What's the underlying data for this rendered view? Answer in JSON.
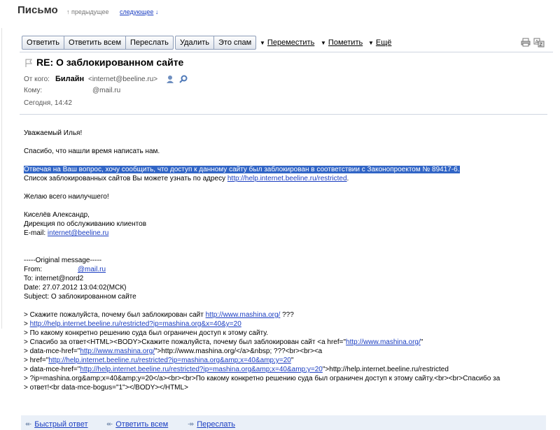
{
  "header": {
    "title": "Письмо",
    "prev_label": "предыдущее",
    "next_label": "следующее"
  },
  "toolbar": {
    "reply": "Ответить",
    "reply_all": "Ответить всем",
    "forward": "Переслать",
    "delete": "Удалить",
    "spam": "Это спам",
    "move": "Переместить",
    "mark": "Пометить",
    "more": "Ещё"
  },
  "message": {
    "subject": "RE: О заблокированном сайте",
    "from_label": "От кого:",
    "from_name": "Билайн",
    "from_email": "<internet@beeline.ru>",
    "to_label": "Кому:",
    "to_value": "@mail.ru",
    "date": "Сегодня, 14:42"
  },
  "body": {
    "greeting": "Уважаемый Илья!",
    "thanks": "Спасибо, что нашли время написать нам.",
    "highlighted": "Отвечая на Ваш вопрос, хочу сообщить, что доступ к данному сайту был заблокирован в соответствии с Законопроектом № 89417-6.",
    "list_prefix": "Список заблокированных сайтов Вы можете узнать по адресу",
    "list_link": "http://help.internet.beeline.ru/restricted",
    "list_suffix": ".",
    "wish": "Желаю всего наилучшего!",
    "sig_name": "Киселёв Александр,",
    "sig_dept": "Дирекция по обслуживанию клиентов",
    "sig_email_prefix": "E-mail: ",
    "sig_email": "internet@beeline.ru",
    "orig_header": "-----Original message-----",
    "orig_from_label": "From:",
    "orig_from_value": "@mail.ru",
    "orig_to": "To: internet@nord2",
    "orig_date": "Date: 27.07.2012 13:04:02(МСК)",
    "orig_subject": "Subject: О заблокированном сайте",
    "q1_prefix": "> Скажите пожалуйста, почему был заблокирован сайт ",
    "q1_link": "http://www.mashina.org/",
    "q1_suffix": "  ???",
    "q2_prefix": "> ",
    "q2_link": "http://help.internet.beeline.ru/restricted?ip=mashina.org&x=40&y=20",
    "q3": "> По какому конкретно решению суда был ограничен доступ к этому сайту.",
    "q4_prefix": "> Спасибо за ответ<HTML><BODY>Скажите пожалуйста, почему был заблокирован сайт <a href=\"",
    "q4_link": "http://www.mashina.org/",
    "q4_suffix": "\"",
    "q5_prefix": "> data-mce-href=\"",
    "q5_link": "http://www.mashina.org/",
    "q5_suffix": "\">http://www.mashina.org/</a>&nbsp; ???<br><br><a",
    "q6_prefix": "> href=\"",
    "q6_link": "http://help.internet.beeline.ru/restricted?ip=mashina.org&amp;x=40&amp;y=20",
    "q6_suffix": "\"",
    "q7_prefix": "> data-mce-href=\"",
    "q7_link": "http://help.internet.beeline.ru/restricted?ip=mashina.org&amp;x=40&amp;y=20",
    "q7_suffix": "\">http://help.internet.beeline.ru/restricted",
    "q8": "> ?ip=mashina.org&amp;x=40&amp;y=20</a><br><br>По какому конкретно решению суда был ограничен доступ к этому сайту.<br><br>Спасибо за",
    "q9": "> ответ!<br data-mce-bogus=\"1\"></BODY></HTML>"
  },
  "footer": {
    "quick_reply": "Быстрый ответ",
    "reply_all": "Ответить всем",
    "forward": "Переслать"
  }
}
